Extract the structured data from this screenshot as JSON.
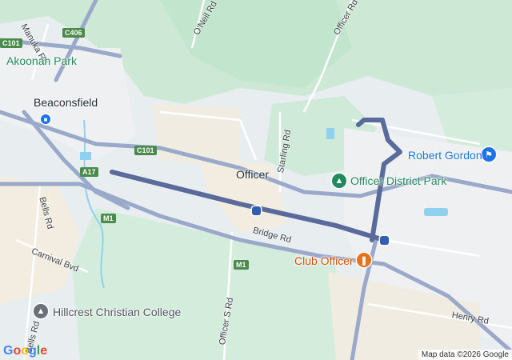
{
  "map": {
    "places": {
      "akoonah_park": "Akoonah Park",
      "beaconsfield": "Beaconsfield",
      "officer": "Officer",
      "hillcrest": "Hillcrest Christian College"
    },
    "pois": {
      "robert_gordon": "Robert Gordon",
      "officer_district_park": "Officer District Park",
      "club_officer": "Club Officer"
    },
    "roads": {
      "manuka_rd": "Manuka Rd",
      "oneil_rd": "O'Neil Rd",
      "officer_rd": "Officer Rd",
      "starling_rd": "Starling Rd",
      "bridge_rd": "Bridge Rd",
      "bells_rd": "Bells Rd",
      "bells_rd_2": "Bells Rd",
      "carnival_bvd": "Carnival Bvd",
      "officer_s_rd": "Officer S Rd",
      "henry_rd": "Henry Rd"
    },
    "shields": {
      "c101_a": "C101",
      "c406": "C406",
      "c101_b": "C101",
      "a17": "A17",
      "m1_a": "M1",
      "m1_b": "M1"
    },
    "logo": "Google",
    "attribution": "Map data ©2026 Google",
    "colors": {
      "land": "#e8eef0",
      "park": "#cde9d6",
      "forest": "#b9e3c6",
      "urban": "#f1ece2",
      "road_major": "#8a9bc0",
      "route": "#5a6a9a",
      "water": "#8fd2f0"
    }
  }
}
